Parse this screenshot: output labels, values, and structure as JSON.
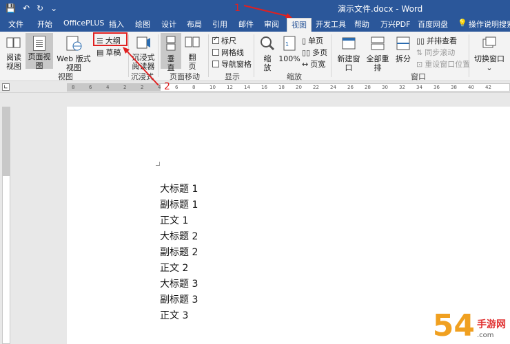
{
  "window": {
    "title": "演示文件.docx - Word",
    "quick_access": [
      "💾",
      "↶",
      "↻",
      "⌄"
    ]
  },
  "tabs": [
    {
      "label": "文件"
    },
    {
      "label": "开始"
    },
    {
      "label": "OfficePLUS"
    },
    {
      "label": "插入"
    },
    {
      "label": "绘图"
    },
    {
      "label": "设计"
    },
    {
      "label": "布局"
    },
    {
      "label": "引用"
    },
    {
      "label": "邮件"
    },
    {
      "label": "审阅"
    },
    {
      "label": "视图",
      "active": true
    },
    {
      "label": "开发工具"
    },
    {
      "label": "帮助"
    },
    {
      "label": "万兴PDF"
    },
    {
      "label": "百度网盘"
    },
    {
      "label": "操作说明搜索"
    }
  ],
  "ribbon": {
    "views": {
      "read_mode_line1": "阅读",
      "read_mode_line2": "视图",
      "print_layout": "页面视图",
      "web_layout": "Web 版式视图",
      "outline": "大纲",
      "draft": "草稿",
      "group_label": "视图"
    },
    "immersive": {
      "reader_line1": "沉浸式",
      "reader_line2": "阅读器",
      "group_label": "沉浸式"
    },
    "page_movement": {
      "vertical_line1": "垂",
      "vertical_line2": "直",
      "side_line1": "翻",
      "side_line2": "页",
      "group_label": "页面移动"
    },
    "show": {
      "ruler": "标尺",
      "gridlines": "网格线",
      "nav_pane": "导航窗格",
      "group_label": "显示"
    },
    "zoom": {
      "zoom_line1": "缩",
      "zoom_line2": "放",
      "hundred": "100%",
      "one_page": "单页",
      "multi_page": "多页",
      "page_width": "页宽",
      "group_label": "缩放"
    },
    "window": {
      "new_window": "新建窗口",
      "arrange_all": "全部重排",
      "split": "拆分",
      "side_by_side": "并排查看",
      "sync_scroll": "同步滚动",
      "reset_position": "重设窗口位置",
      "group_label": "窗口"
    },
    "switch_window": {
      "label": "切换窗口"
    }
  },
  "ruler": {
    "ticks": [
      "8",
      "6",
      "4",
      "2",
      "2",
      "4",
      "6",
      "8",
      "10",
      "12",
      "14",
      "16",
      "18",
      "20",
      "22",
      "24",
      "26",
      "28",
      "30",
      "32",
      "34",
      "36",
      "38",
      "40",
      "42"
    ]
  },
  "annotations": {
    "step1": "1",
    "step2": "2"
  },
  "document": {
    "lines": [
      "大标题 1",
      "副标题 1",
      "正文 1",
      "大标题 2",
      "副标题 2",
      "正文 2",
      "大标题 3",
      "副标题 3",
      "正文 3"
    ]
  },
  "watermark": {
    "big": "54",
    "side_top": "手游网",
    "side_bottom": ".com"
  },
  "colors": {
    "title_bar": "#2b579a",
    "annotation_red": "#e02020",
    "watermark_orange": "#f0a020"
  }
}
